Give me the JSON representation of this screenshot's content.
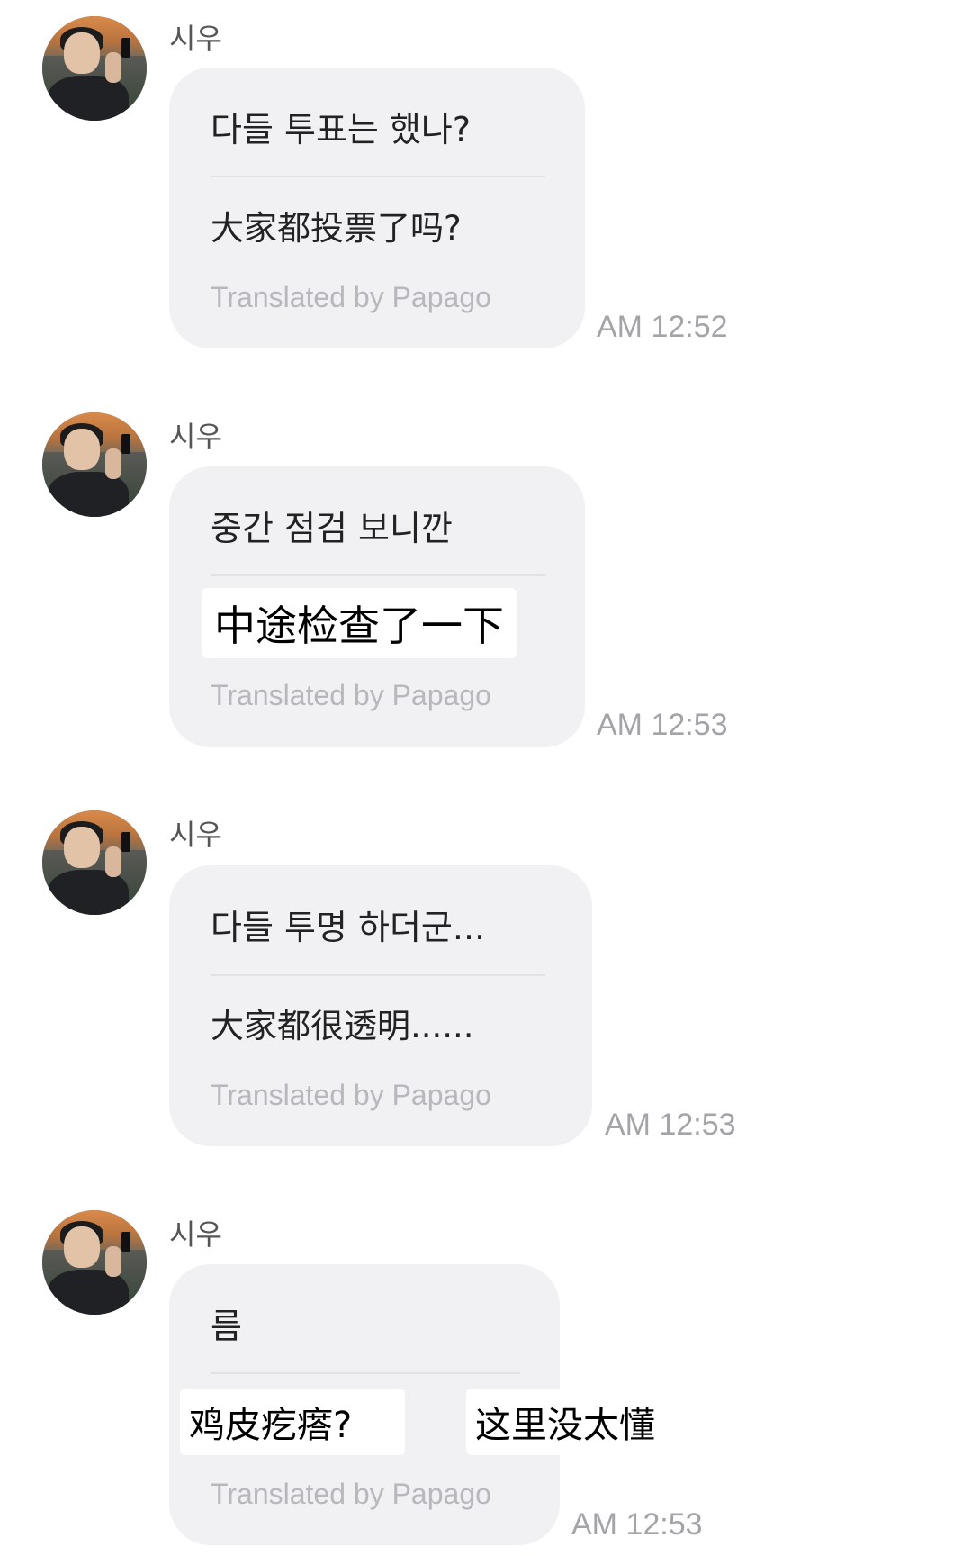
{
  "sender_name": "시우",
  "credit": "Translated by Papago",
  "messages": [
    {
      "original": "다들 투표는 했나?",
      "translation": "大家都投票了吗?",
      "time": "AM 12:52"
    },
    {
      "original": "중간 점검 보니깐",
      "translation": "中途检查了一下",
      "time": "AM 12:53"
    },
    {
      "original": "다들 투명 하더군...",
      "translation": "大家都很透明......",
      "time": "AM 12:53"
    },
    {
      "original": "름",
      "translation": "",
      "time": "AM 12:53"
    }
  ],
  "overlays": {
    "note_left": "鸡皮疙瘩?",
    "note_right": "这里没太懂"
  }
}
